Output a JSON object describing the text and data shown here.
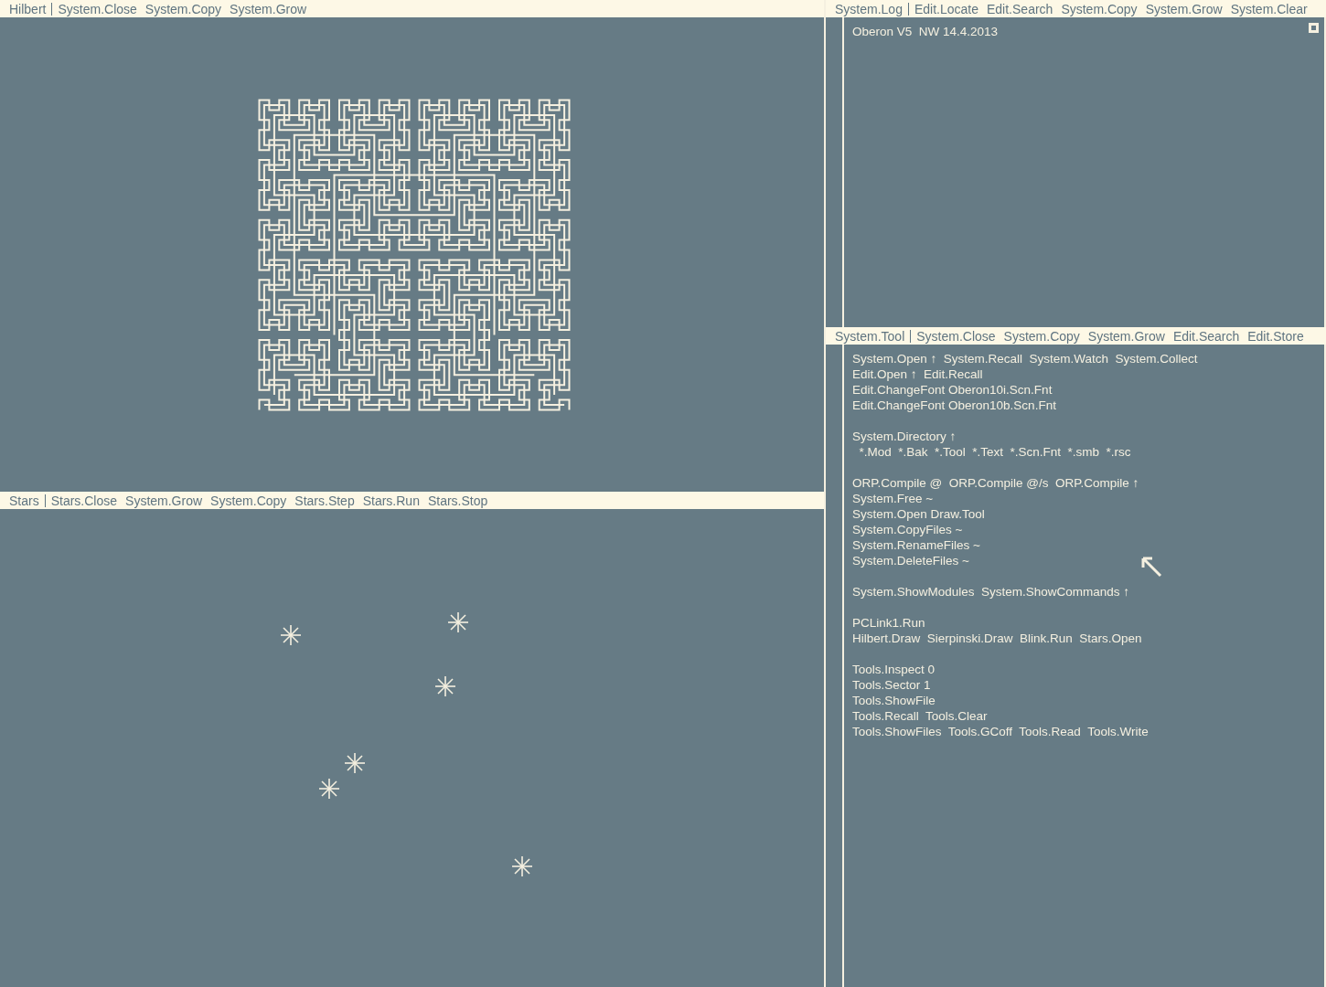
{
  "left_track": [
    {
      "kind": "hilbert",
      "title_bar": {
        "name": "Hilbert",
        "commands": [
          "System.Close",
          "System.Copy",
          "System.Grow"
        ]
      }
    },
    {
      "kind": "stars",
      "title_bar": {
        "name": "Stars",
        "commands": [
          "Stars.Close",
          "System.Grow",
          "System.Copy",
          "Stars.Step",
          "Stars.Run",
          "Stars.Stop"
        ]
      }
    }
  ],
  "right_track": [
    {
      "kind": "log",
      "title_bar": {
        "name": "System.Log",
        "commands": [
          "Edit.Locate",
          "Edit.Search",
          "System.Copy",
          "System.Grow",
          "System.Clear"
        ]
      },
      "paragraphs": [
        [
          "Oberon V5  NW 14.4.2013"
        ]
      ]
    },
    {
      "kind": "tool",
      "title_bar": {
        "name": "System.Tool",
        "commands": [
          "System.Close",
          "System.Copy",
          "System.Grow",
          "Edit.Search",
          "Edit.Store"
        ]
      },
      "paragraphs": [
        [
          "System.Open ↑  System.Recall  System.Watch  System.Collect",
          "Edit.Open ↑  Edit.Recall",
          "Edit.ChangeFont Oberon10i.Scn.Fnt",
          "Edit.ChangeFont Oberon10b.Scn.Fnt"
        ],
        [
          "System.Directory ↑",
          "  *.Mod  *.Bak  *.Tool  *.Text  *.Scn.Fnt  *.smb  *.rsc"
        ],
        [
          "ORP.Compile @  ORP.Compile @/s  ORP.Compile ↑",
          "System.Free ~",
          "System.Open Draw.Tool",
          "System.CopyFiles ~",
          "System.RenameFiles ~",
          "System.DeleteFiles ~"
        ],
        [
          "System.ShowModules  System.ShowCommands ↑"
        ],
        [
          "PCLink1.Run",
          "Hilbert.Draw  Sierpinski.Draw  Blink.Run  Stars.Open"
        ],
        [
          "Tools.Inspect 0",
          "Tools.Sector 1",
          "Tools.ShowFile",
          "Tools.Recall  Tools.Clear",
          "Tools.ShowFiles  Tools.GCoff  Tools.Read  Tools.Write"
        ]
      ]
    }
  ]
}
